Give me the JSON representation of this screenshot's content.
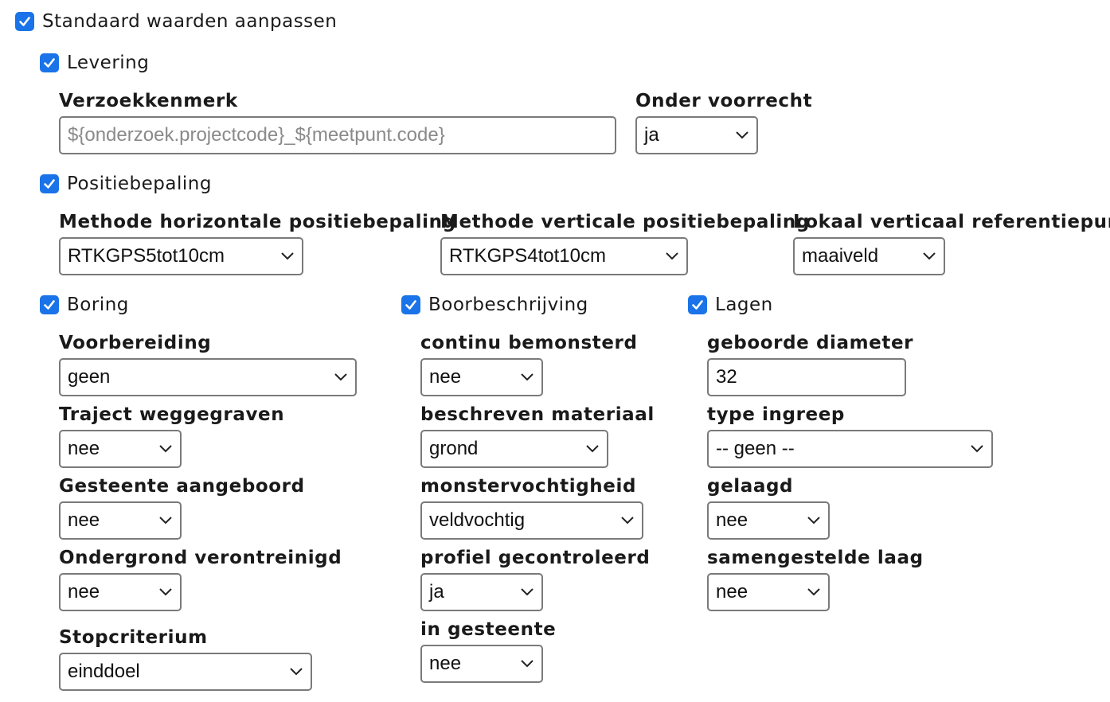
{
  "main_toggle": {
    "label": "Standaard waarden aanpassen",
    "checked": true
  },
  "levering": {
    "label": "Levering",
    "verzoekkenmerk": {
      "label": "Verzoekkenmerk",
      "placeholder": "${onderzoek.projectcode}_${meetpunt.code}"
    },
    "onder_voorrecht": {
      "label": "Onder voorrecht",
      "value": "ja"
    }
  },
  "positiebepaling": {
    "label": "Positiebepaling",
    "horizontaal": {
      "label": "Methode horizontale positiebepaling",
      "value": "RTKGPS5tot10cm"
    },
    "verticaal": {
      "label": "Methode verticale positiebepaling",
      "value": "RTKGPS4tot10cm"
    },
    "referentiepunt": {
      "label": "Lokaal verticaal referentiepunt",
      "value": "maaiveld"
    }
  },
  "boring": {
    "label": "Boring",
    "voorbereiding": {
      "label": "Voorbereiding",
      "value": "geen"
    },
    "traject": {
      "label": "Traject weggegraven",
      "value": "nee"
    },
    "gesteente": {
      "label": "Gesteente aangeboord",
      "value": "nee"
    },
    "ondergrond": {
      "label": "Ondergrond verontreinigd",
      "value": "nee"
    },
    "stopcriterium": {
      "label": "Stopcriterium",
      "value": "einddoel"
    }
  },
  "boorbeschrijving": {
    "label": "Boorbeschrijving",
    "continu": {
      "label": "continu bemonsterd",
      "value": "nee"
    },
    "materiaal": {
      "label": "beschreven materiaal",
      "value": "grond"
    },
    "vochtigheid": {
      "label": "monstervochtigheid",
      "value": "veldvochtig"
    },
    "profiel": {
      "label": "profiel gecontroleerd",
      "value": "ja"
    },
    "in_gesteente": {
      "label": "in gesteente",
      "value": "nee"
    }
  },
  "lagen": {
    "label": "Lagen",
    "diameter": {
      "label": "geboorde diameter",
      "value": "32"
    },
    "ingreep": {
      "label": "type ingreep",
      "value": "-- geen --"
    },
    "gelaagd": {
      "label": "gelaagd",
      "value": "nee"
    },
    "samengesteld": {
      "label": "samengestelde laag",
      "value": "nee"
    }
  },
  "colors": {
    "checkbox": "#1a73e8",
    "border": "#7a7a7a",
    "placeholder": "#8a8a8a"
  },
  "icons": {
    "checkbox": "checkmark-icon",
    "select": "chevron-down-icon"
  }
}
